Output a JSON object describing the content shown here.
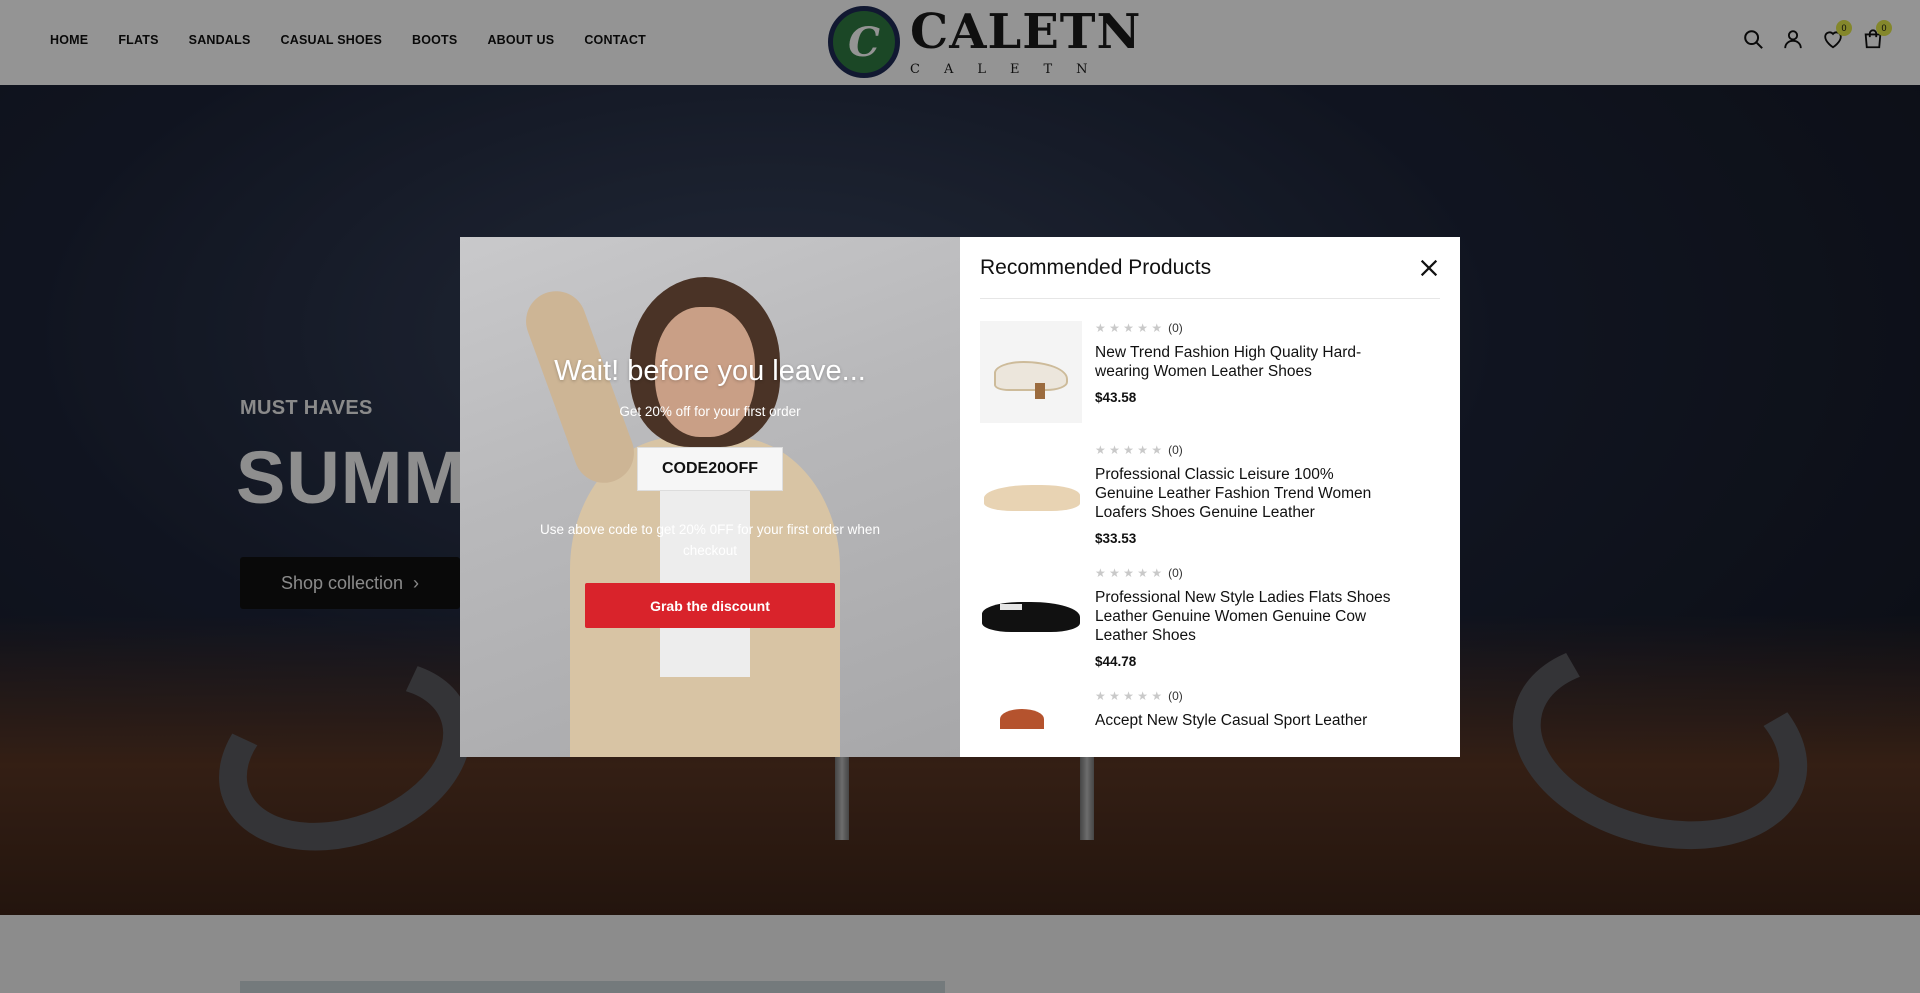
{
  "nav": [
    "HOME",
    "FLATS",
    "SANDALS",
    "CASUAL SHOES",
    "BOOTS",
    "ABOUT US",
    "CONTACT"
  ],
  "logo": {
    "mark": "C",
    "title": "CALETN",
    "subtitle": "CALETN"
  },
  "header_icons": {
    "search": "search-icon",
    "account": "user-icon",
    "wishlist": {
      "icon": "heart-icon",
      "count": "0"
    },
    "cart": {
      "icon": "bag-icon",
      "count": "0"
    }
  },
  "hero": {
    "label": "MUST HAVES",
    "title": "SUMM",
    "button": "Shop collection"
  },
  "popup": {
    "title": "Wait! before you leave...",
    "subtitle": "Get 20% off for your first order",
    "code": "CODE20OFF",
    "note": "Use above code to get 20% 0FF for your first order when checkout",
    "button": "Grab the discount"
  },
  "recommended": {
    "title": "Recommended Products",
    "products": [
      {
        "rating_count": "(0)",
        "name": "New Trend Fashion High Quality Hard-wearing Women Leather Shoes",
        "price": "$43.58"
      },
      {
        "rating_count": "(0)",
        "name": "Professional Classic Leisure 100% Genuine Leather Fashion Trend Women Loafers Shoes Genuine Leather",
        "price": "$33.53"
      },
      {
        "rating_count": "(0)",
        "name": "Professional New Style Ladies Flats Shoes Leather Genuine Women Genuine Cow Leather Shoes",
        "price": "$44.78"
      },
      {
        "rating_count": "(0)",
        "name": "Accept New Style Casual Sport Leather",
        "price": ""
      }
    ]
  },
  "colors": {
    "accent_red": "#d9232b",
    "badge": "#e3e84a"
  }
}
